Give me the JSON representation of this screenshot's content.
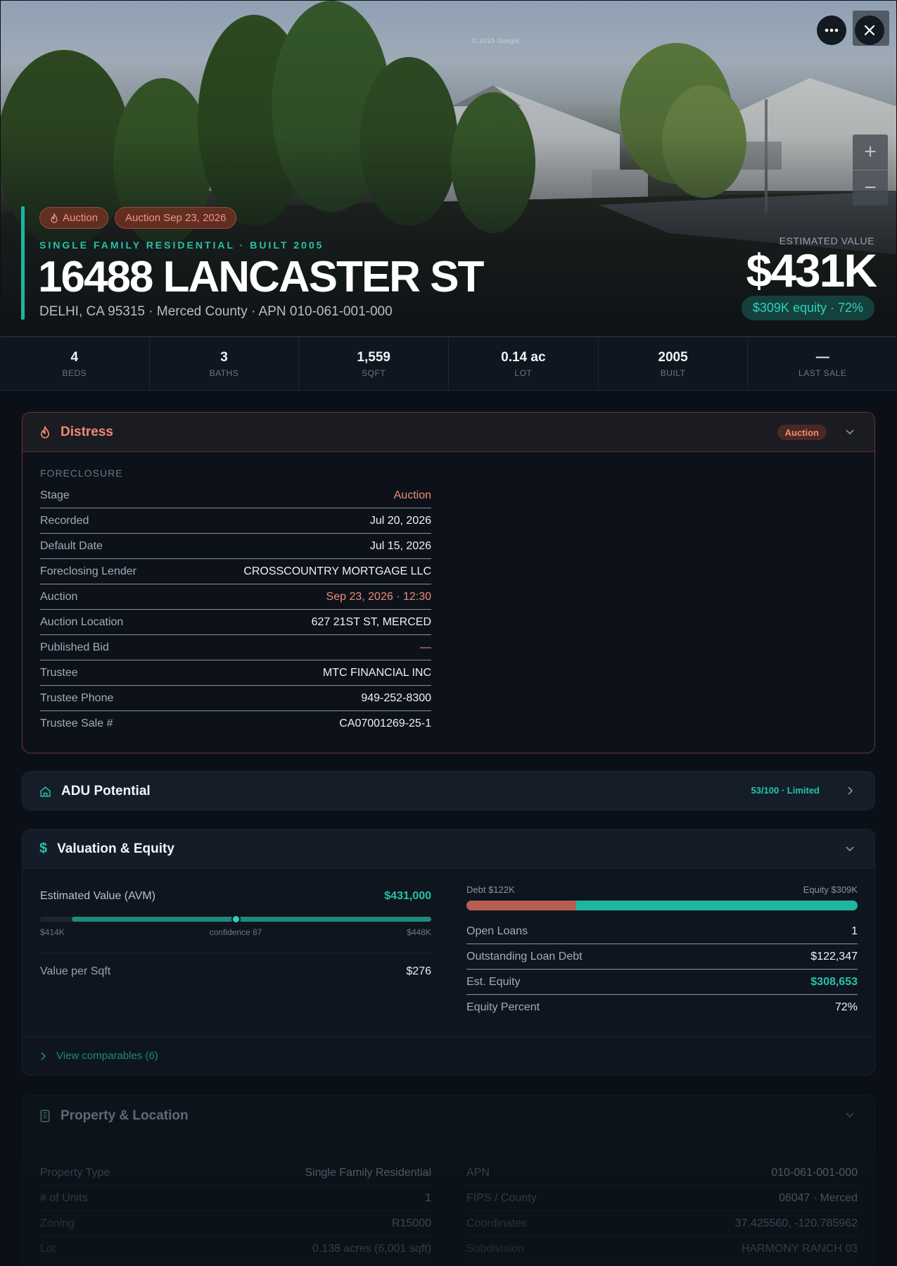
{
  "hero": {
    "watermark": "© 2025 Google",
    "badges": [
      "Auction",
      "Auction Sep 23, 2026"
    ],
    "subtitle": "SINGLE FAMILY RESIDENTIAL · BUILT 2005",
    "title": "16488 LANCASTER ST",
    "address": "DELHI, CA 95315 · Merced County · APN 010-061-001-000",
    "estimated_label": "ESTIMATED VALUE",
    "estimated_value": "$431K",
    "equity_pill": "$309K equity · 72%",
    "zoom_in": "+",
    "zoom_out": "−"
  },
  "stats": [
    {
      "value": "4",
      "label": "BEDS"
    },
    {
      "value": "3",
      "label": "BATHS"
    },
    {
      "value": "1,559",
      "label": "SQFT"
    },
    {
      "value": "0.14 ac",
      "label": "LOT"
    },
    {
      "value": "2005",
      "label": "BUILT"
    },
    {
      "value": "—",
      "label": "LAST SALE"
    }
  ],
  "distress": {
    "title": "Distress",
    "badge": "Auction",
    "section": "FORECLOSURE",
    "rows": [
      {
        "k": "Stage",
        "v": "Auction"
      },
      {
        "k": "Recorded",
        "v": "Jul 20, 2026"
      },
      {
        "k": "Default Date",
        "v": "Jul 15, 2026"
      },
      {
        "k": "Foreclosing Lender",
        "v": "CROSSCOUNTRY MORTGAGE LLC"
      },
      {
        "k": "Auction",
        "v": "Sep 23, 2026 · 12:30"
      },
      {
        "k": "Auction Location",
        "v": "627 21ST ST, MERCED"
      },
      {
        "k": "Published Bid",
        "v": "—"
      },
      {
        "k": "Trustee",
        "v": "MTC FINANCIAL INC"
      },
      {
        "k": "Trustee Phone",
        "v": "949-252-8300"
      },
      {
        "k": "Trustee Sale #",
        "v": "CA07001269-25-1"
      }
    ]
  },
  "adu": {
    "title": "ADU Potential",
    "score": "53/100 · Limited"
  },
  "valuation": {
    "title": "Valuation & Equity",
    "avm_label": "Estimated Value (AVM)",
    "avm_value": "$431,000",
    "range_low": "$414K",
    "confidence": "confidence 87",
    "range_high": "$448K",
    "value_per_sqft_label": "Value per Sqft",
    "value_per_sqft": "$276",
    "debt_label": "Debt $122K",
    "equity_label": "Equity $309K",
    "debt_fraction": 0.28,
    "rows": [
      {
        "k": "Open Loans",
        "v": "1"
      },
      {
        "k": "Outstanding Loan Debt",
        "v": "$122,347"
      },
      {
        "k": "Est. Equity",
        "v": "$308,653"
      },
      {
        "k": "Equity Percent",
        "v": "72%"
      }
    ],
    "comparables": "View comparables (6)"
  },
  "property": {
    "title": "Property & Location",
    "left_rows": [
      {
        "k": "Property Type",
        "v": "Single Family Residential"
      },
      {
        "k": "# of Units",
        "v": "1"
      },
      {
        "k": "Zoning",
        "v": "R15000"
      },
      {
        "k": "Lot",
        "v": "0.138 acres (6,001 sqft)"
      }
    ],
    "right_rows": [
      {
        "k": "APN",
        "v": "010-061-001-000"
      },
      {
        "k": "FIPS / County",
        "v": "06047 · Merced"
      },
      {
        "k": "Coordinates",
        "v": "37.425560, -120.785962"
      },
      {
        "k": "Subdivision",
        "v": "HARMONY RANCH 03"
      }
    ]
  },
  "colors": {
    "accent": "#1fb5a0",
    "distress": "#f08a74",
    "background": "#0b1018"
  }
}
